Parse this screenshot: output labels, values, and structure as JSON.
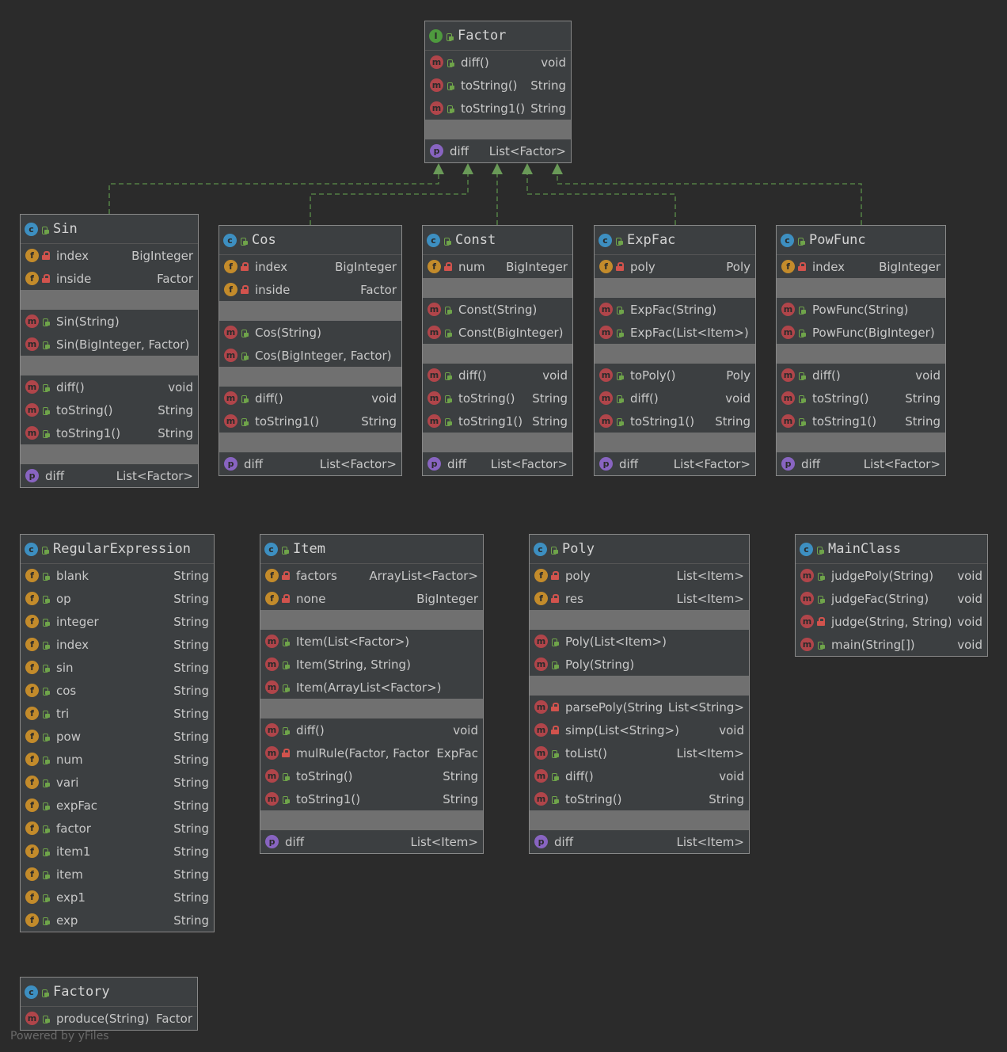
{
  "diagram": {
    "classes": [
      {
        "id": "factor",
        "name": "Factor",
        "kind": "interface",
        "sections": [
          [
            {
              "badge": "m",
              "vis": "public",
              "name": "diff()",
              "type": "void"
            },
            {
              "badge": "m",
              "vis": "public",
              "name": "toString()",
              "type": "String"
            },
            {
              "badge": "m",
              "vis": "public",
              "name": "toString1()",
              "type": "String"
            }
          ],
          [],
          [
            {
              "badge": "p",
              "vis": "",
              "name": "diff",
              "type": "List<Factor>"
            }
          ]
        ]
      },
      {
        "id": "sin",
        "name": "Sin",
        "kind": "class",
        "sections": [
          [
            {
              "badge": "f",
              "vis": "private",
              "name": "index",
              "type": "BigInteger"
            },
            {
              "badge": "f",
              "vis": "private",
              "name": "inside",
              "type": "Factor"
            }
          ],
          [],
          [
            {
              "badge": "m",
              "vis": "public",
              "name": "Sin(String)",
              "type": ""
            },
            {
              "badge": "m",
              "vis": "public",
              "name": "Sin(BigInteger, Factor)",
              "type": ""
            }
          ],
          [],
          [
            {
              "badge": "m",
              "vis": "public",
              "name": "diff()",
              "type": "void"
            },
            {
              "badge": "m",
              "vis": "public",
              "name": "toString()",
              "type": "String"
            },
            {
              "badge": "m",
              "vis": "public",
              "name": "toString1()",
              "type": "String"
            }
          ],
          [],
          [
            {
              "badge": "p",
              "vis": "",
              "name": "diff",
              "type": "List<Factor>"
            }
          ]
        ]
      },
      {
        "id": "cos",
        "name": "Cos",
        "kind": "class",
        "sections": [
          [
            {
              "badge": "f",
              "vis": "private",
              "name": "index",
              "type": "BigInteger"
            },
            {
              "badge": "f",
              "vis": "private",
              "name": "inside",
              "type": "Factor"
            }
          ],
          [],
          [
            {
              "badge": "m",
              "vis": "public",
              "name": "Cos(String)",
              "type": ""
            },
            {
              "badge": "m",
              "vis": "public",
              "name": "Cos(BigInteger, Factor)",
              "type": ""
            }
          ],
          [],
          [
            {
              "badge": "m",
              "vis": "public",
              "name": "diff()",
              "type": "void"
            },
            {
              "badge": "m",
              "vis": "public",
              "name": "toString1()",
              "type": "String"
            }
          ],
          [],
          [
            {
              "badge": "p",
              "vis": "",
              "name": "diff",
              "type": "List<Factor>"
            }
          ]
        ]
      },
      {
        "id": "const",
        "name": "Const",
        "kind": "class",
        "sections": [
          [
            {
              "badge": "f",
              "vis": "private",
              "name": "num",
              "type": "BigInteger"
            }
          ],
          [],
          [
            {
              "badge": "m",
              "vis": "public",
              "name": "Const(String)",
              "type": ""
            },
            {
              "badge": "m",
              "vis": "public",
              "name": "Const(BigInteger)",
              "type": ""
            }
          ],
          [],
          [
            {
              "badge": "m",
              "vis": "public",
              "name": "diff()",
              "type": "void"
            },
            {
              "badge": "m",
              "vis": "public",
              "name": "toString()",
              "type": "String"
            },
            {
              "badge": "m",
              "vis": "public",
              "name": "toString1()",
              "type": "String"
            }
          ],
          [],
          [
            {
              "badge": "p",
              "vis": "",
              "name": "diff",
              "type": "List<Factor>"
            }
          ]
        ]
      },
      {
        "id": "expfac",
        "name": "ExpFac",
        "kind": "class",
        "sections": [
          [
            {
              "badge": "f",
              "vis": "private",
              "name": "poly",
              "type": "Poly"
            }
          ],
          [],
          [
            {
              "badge": "m",
              "vis": "public",
              "name": "ExpFac(String)",
              "type": ""
            },
            {
              "badge": "m",
              "vis": "public",
              "name": "ExpFac(List<Item>)",
              "type": ""
            }
          ],
          [],
          [
            {
              "badge": "m",
              "vis": "public",
              "name": "toPoly()",
              "type": "Poly"
            },
            {
              "badge": "m",
              "vis": "public",
              "name": "diff()",
              "type": "void"
            },
            {
              "badge": "m",
              "vis": "public",
              "name": "toString1()",
              "type": "String"
            }
          ],
          [],
          [
            {
              "badge": "p",
              "vis": "",
              "name": "diff",
              "type": "List<Factor>"
            }
          ]
        ]
      },
      {
        "id": "powfunc",
        "name": "PowFunc",
        "kind": "class",
        "sections": [
          [
            {
              "badge": "f",
              "vis": "private",
              "name": "index",
              "type": "BigInteger"
            }
          ],
          [],
          [
            {
              "badge": "m",
              "vis": "public",
              "name": "PowFunc(String)",
              "type": ""
            },
            {
              "badge": "m",
              "vis": "public",
              "name": "PowFunc(BigInteger)",
              "type": ""
            }
          ],
          [],
          [
            {
              "badge": "m",
              "vis": "public",
              "name": "diff()",
              "type": "void"
            },
            {
              "badge": "m",
              "vis": "public",
              "name": "toString()",
              "type": "String"
            },
            {
              "badge": "m",
              "vis": "public",
              "name": "toString1()",
              "type": "String"
            }
          ],
          [],
          [
            {
              "badge": "p",
              "vis": "",
              "name": "diff",
              "type": "List<Factor>"
            }
          ]
        ]
      },
      {
        "id": "regex",
        "name": "RegularExpression",
        "kind": "class",
        "sections": [
          [
            {
              "badge": "f",
              "vis": "public",
              "name": "blank",
              "type": "String"
            },
            {
              "badge": "f",
              "vis": "public",
              "name": "op",
              "type": "String"
            },
            {
              "badge": "f",
              "vis": "public",
              "name": "integer",
              "type": "String"
            },
            {
              "badge": "f",
              "vis": "public",
              "name": "index",
              "type": "String"
            },
            {
              "badge": "f",
              "vis": "public",
              "name": "sin",
              "type": "String"
            },
            {
              "badge": "f",
              "vis": "public",
              "name": "cos",
              "type": "String"
            },
            {
              "badge": "f",
              "vis": "public",
              "name": "tri",
              "type": "String"
            },
            {
              "badge": "f",
              "vis": "public",
              "name": "pow",
              "type": "String"
            },
            {
              "badge": "f",
              "vis": "public",
              "name": "num",
              "type": "String"
            },
            {
              "badge": "f",
              "vis": "public",
              "name": "vari",
              "type": "String"
            },
            {
              "badge": "f",
              "vis": "public",
              "name": "expFac",
              "type": "String"
            },
            {
              "badge": "f",
              "vis": "public",
              "name": "factor",
              "type": "String"
            },
            {
              "badge": "f",
              "vis": "public",
              "name": "item1",
              "type": "String"
            },
            {
              "badge": "f",
              "vis": "public",
              "name": "item",
              "type": "String"
            },
            {
              "badge": "f",
              "vis": "public",
              "name": "exp1",
              "type": "String"
            },
            {
              "badge": "f",
              "vis": "public",
              "name": "exp",
              "type": "String"
            }
          ]
        ]
      },
      {
        "id": "item",
        "name": "Item",
        "kind": "class",
        "sections": [
          [
            {
              "badge": "f",
              "vis": "private",
              "name": "factors",
              "type": "ArrayList<Factor>"
            },
            {
              "badge": "f",
              "vis": "private",
              "name": "none",
              "type": "BigInteger"
            }
          ],
          [],
          [
            {
              "badge": "m",
              "vis": "public",
              "name": "Item(List<Factor>)",
              "type": ""
            },
            {
              "badge": "m",
              "vis": "public",
              "name": "Item(String, String)",
              "type": ""
            },
            {
              "badge": "m",
              "vis": "public",
              "name": "Item(ArrayList<Factor>)",
              "type": ""
            }
          ],
          [],
          [
            {
              "badge": "m",
              "vis": "public",
              "name": "diff()",
              "type": "void"
            },
            {
              "badge": "m",
              "vis": "private",
              "name": "mulRule(Factor, Factor)",
              "type": "ExpFac"
            },
            {
              "badge": "m",
              "vis": "public",
              "name": "toString()",
              "type": "String"
            },
            {
              "badge": "m",
              "vis": "public",
              "name": "toString1()",
              "type": "String"
            }
          ],
          [],
          [
            {
              "badge": "p",
              "vis": "",
              "name": "diff",
              "type": "List<Item>"
            }
          ]
        ]
      },
      {
        "id": "poly",
        "name": "Poly",
        "kind": "class",
        "sections": [
          [
            {
              "badge": "f",
              "vis": "private",
              "name": "poly",
              "type": "List<Item>"
            },
            {
              "badge": "f",
              "vis": "private",
              "name": "res",
              "type": "List<Item>"
            }
          ],
          [],
          [
            {
              "badge": "m",
              "vis": "public",
              "name": "Poly(List<Item>)",
              "type": ""
            },
            {
              "badge": "m",
              "vis": "public",
              "name": "Poly(String)",
              "type": ""
            }
          ],
          [],
          [
            {
              "badge": "m",
              "vis": "private",
              "name": "parsePoly(String)",
              "type": "List<String>"
            },
            {
              "badge": "m",
              "vis": "private",
              "name": "simp(List<String>)",
              "type": "void"
            },
            {
              "badge": "m",
              "vis": "public",
              "name": "toList()",
              "type": "List<Item>"
            },
            {
              "badge": "m",
              "vis": "public",
              "name": "diff()",
              "type": "void"
            },
            {
              "badge": "m",
              "vis": "public",
              "name": "toString()",
              "type": "String"
            }
          ],
          [],
          [
            {
              "badge": "p",
              "vis": "",
              "name": "diff",
              "type": "List<Item>"
            }
          ]
        ]
      },
      {
        "id": "mainclass",
        "name": "MainClass",
        "kind": "class",
        "sections": [
          [
            {
              "badge": "m",
              "vis": "public",
              "name": "judgePoly(String)",
              "type": "void"
            },
            {
              "badge": "m",
              "vis": "public",
              "name": "judgeFac(String)",
              "type": "void"
            },
            {
              "badge": "m",
              "vis": "private",
              "name": "judge(String, String)",
              "type": "void"
            },
            {
              "badge": "m",
              "vis": "public",
              "name": "main(String[])",
              "type": "void"
            }
          ]
        ]
      },
      {
        "id": "factory",
        "name": "Factory",
        "kind": "class",
        "sections": [
          [
            {
              "badge": "m",
              "vis": "public",
              "name": "produce(String)",
              "type": "Factor"
            }
          ]
        ]
      }
    ],
    "edges": [
      {
        "from": "sin",
        "to": "factor",
        "type": "implements"
      },
      {
        "from": "cos",
        "to": "factor",
        "type": "implements"
      },
      {
        "from": "const",
        "to": "factor",
        "type": "implements"
      },
      {
        "from": "expfac",
        "to": "factor",
        "type": "implements"
      },
      {
        "from": "powfunc",
        "to": "factor",
        "type": "implements"
      }
    ],
    "colors": {
      "edge": "#5b8f4a",
      "arrow": "#6a9a58"
    }
  },
  "footer": "Powered by yFiles"
}
